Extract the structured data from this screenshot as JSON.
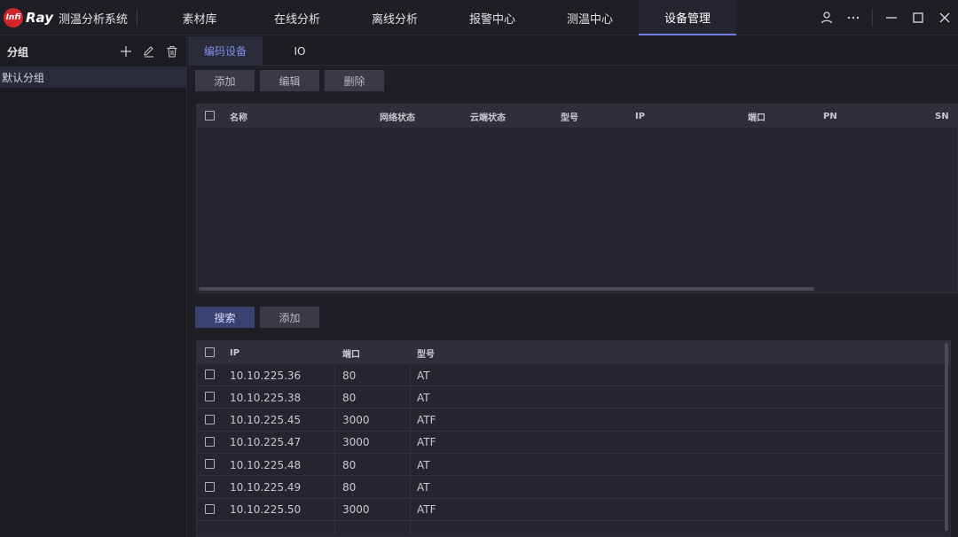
{
  "app": {
    "logo_badge": "Infi",
    "logo_word": "Ray",
    "title": "测温分析系统"
  },
  "nav": {
    "tabs": [
      {
        "label": "素材库",
        "active": false
      },
      {
        "label": "在线分析",
        "active": false
      },
      {
        "label": "离线分析",
        "active": false
      },
      {
        "label": "报警中心",
        "active": false
      },
      {
        "label": "测温中心",
        "active": false
      },
      {
        "label": "设备管理",
        "active": true
      }
    ]
  },
  "window_controls": {
    "user": "user-icon",
    "more": "more-icon",
    "minimize": "minimize-icon",
    "maximize": "maximize-icon",
    "close": "close-icon"
  },
  "sidebar": {
    "header": "分组",
    "groups": [
      {
        "label": "默认分组",
        "selected": true
      }
    ]
  },
  "subtabs": [
    {
      "label": "编码设备",
      "active": true
    },
    {
      "label": "IO",
      "active": false
    }
  ],
  "toolbar_top": {
    "add": "添加",
    "edit": "编辑",
    "delete": "删除"
  },
  "device_table": {
    "columns": [
      "名称",
      "网络状态",
      "云端状态",
      "型号",
      "IP",
      "端口",
      "PN",
      "SN"
    ],
    "rows": []
  },
  "toolbar_bottom": {
    "search": "搜索",
    "add": "添加"
  },
  "search_table": {
    "columns": [
      "IP",
      "端口",
      "型号"
    ],
    "rows": [
      {
        "ip": "10.10.225.36",
        "port": "80",
        "model": "AT"
      },
      {
        "ip": "10.10.225.38",
        "port": "80",
        "model": "AT"
      },
      {
        "ip": "10.10.225.45",
        "port": "3000",
        "model": "ATF"
      },
      {
        "ip": "10.10.225.47",
        "port": "3000",
        "model": "ATF"
      },
      {
        "ip": "10.10.225.48",
        "port": "80",
        "model": "AT"
      },
      {
        "ip": "10.10.225.49",
        "port": "80",
        "model": "AT"
      },
      {
        "ip": "10.10.225.50",
        "port": "3000",
        "model": "ATF"
      }
    ]
  },
  "colors": {
    "accent": "#6f7de0",
    "primary_button": "#3a4070",
    "brand_red": "#d3262c"
  }
}
